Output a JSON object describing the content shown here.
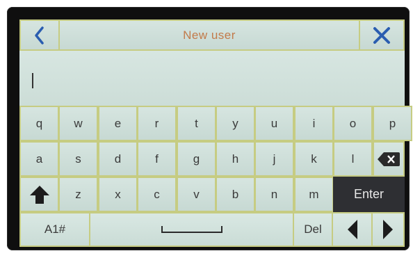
{
  "header": {
    "title": "New user",
    "back_icon": "chevron-left-icon",
    "close_icon": "close-icon"
  },
  "input": {
    "value": ""
  },
  "keyboard": {
    "row1": [
      "q",
      "w",
      "e",
      "r",
      "t",
      "y",
      "u",
      "i",
      "o",
      "p"
    ],
    "row2": [
      "a",
      "s",
      "d",
      "f",
      "g",
      "h",
      "j",
      "k",
      "l"
    ],
    "row3": [
      "z",
      "x",
      "c",
      "v",
      "b",
      "n",
      "m"
    ],
    "enter_label": "Enter",
    "symbols_label": "A1#",
    "delete_label": "Del",
    "shift_icon": "shift-arrow-icon",
    "backspace_icon": "backspace-icon",
    "space_icon": "space-bar-icon",
    "left_arrow_icon": "cursor-left-icon",
    "right_arrow_icon": "cursor-right-icon"
  },
  "colors": {
    "accent_blue": "#2a5db0",
    "grid_border": "#c6cc82",
    "title_text": "#c27a4a",
    "enter_key": "#2e2f33"
  }
}
